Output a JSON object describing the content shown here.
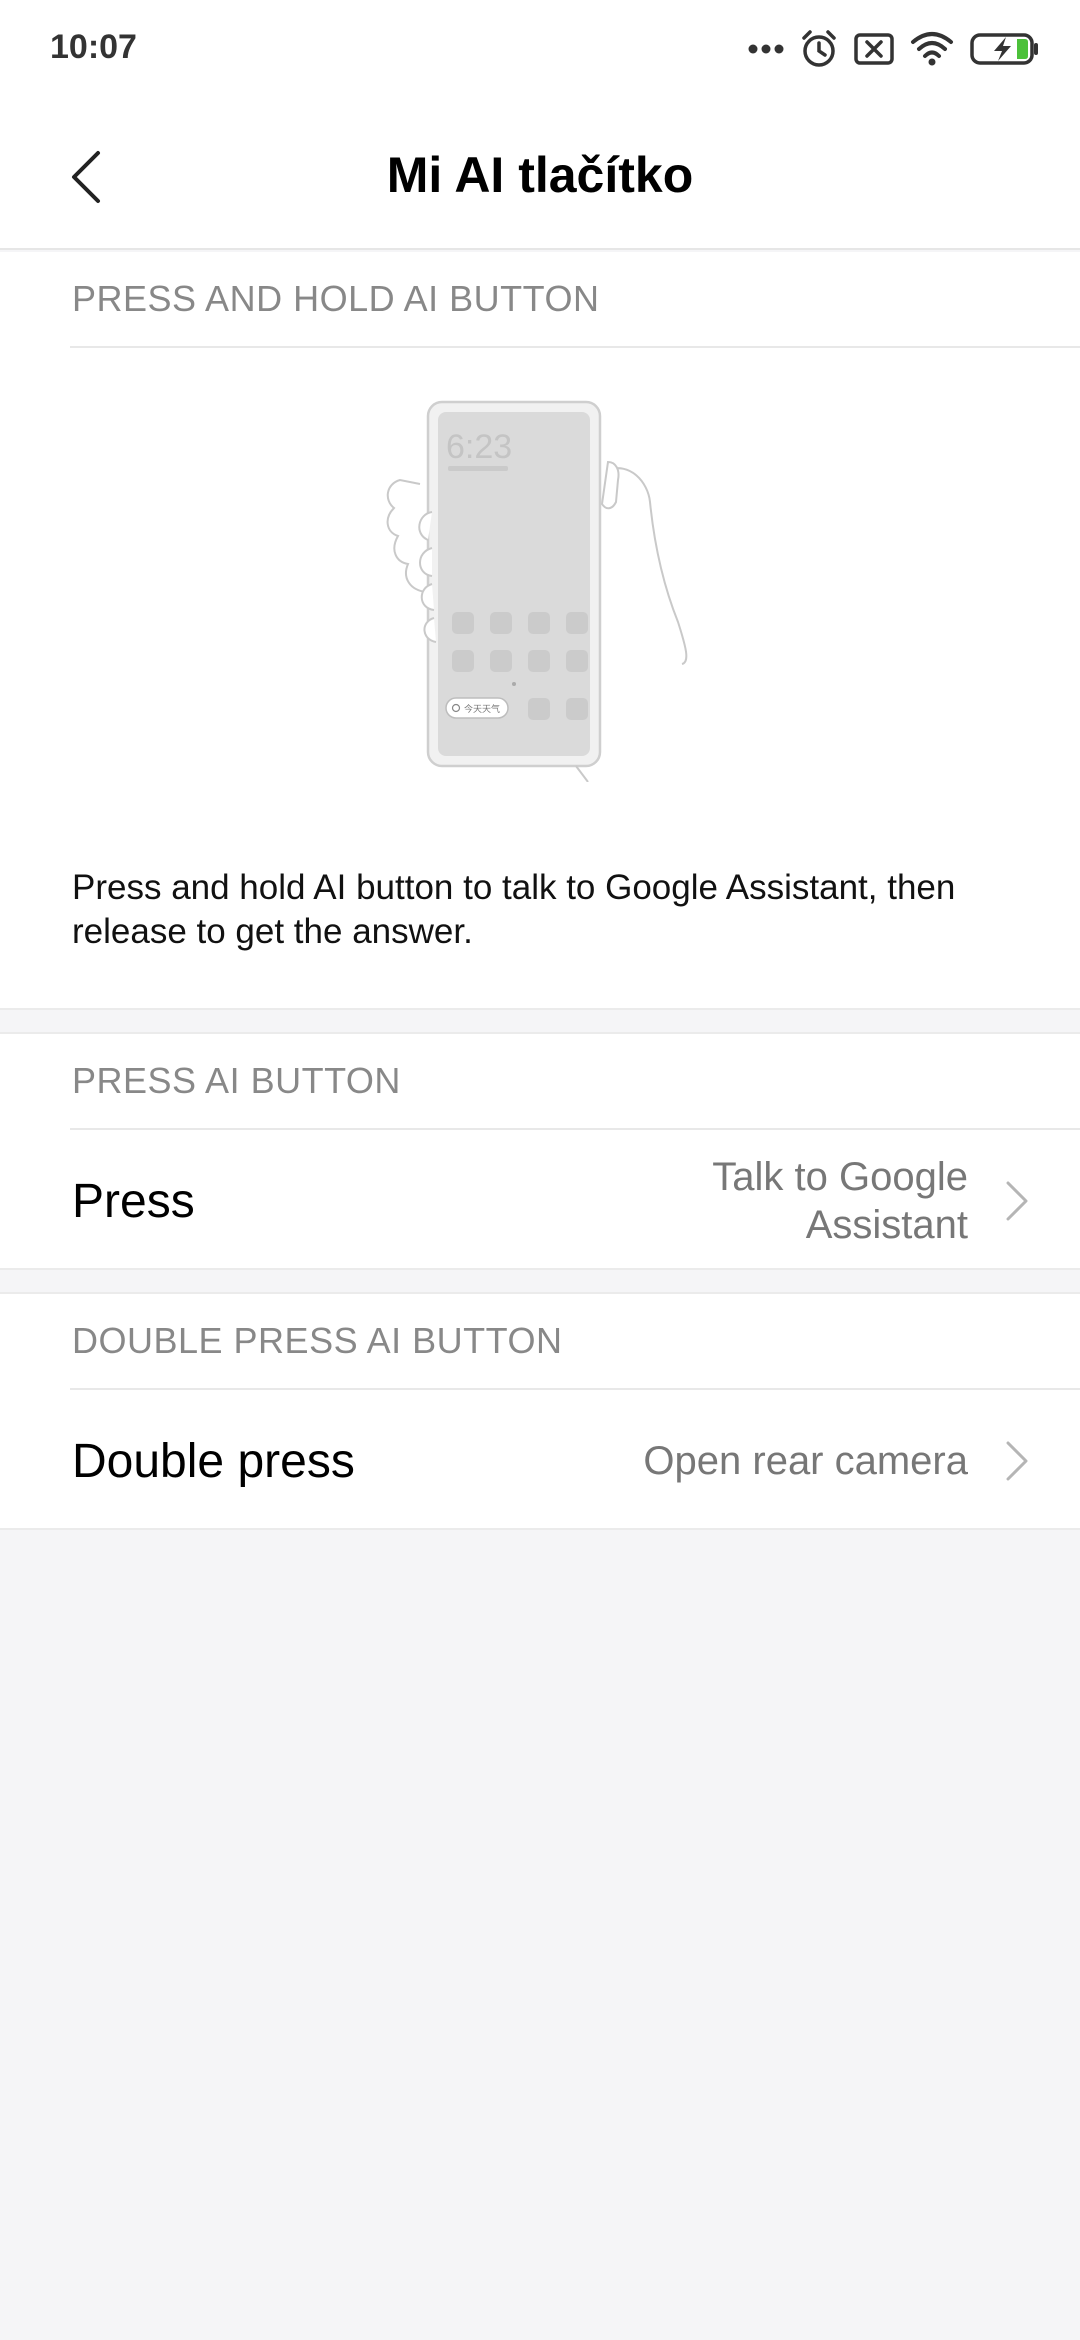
{
  "status_bar": {
    "time": "10:07",
    "icons": [
      "more-dots-icon",
      "alarm-icon",
      "notification-x-icon",
      "wifi-icon",
      "battery-charging-icon"
    ],
    "battery_color": "#4cc13a"
  },
  "header": {
    "title": "Mi AI tlačítko",
    "back_icon": "back-arrow-icon"
  },
  "sections": {
    "hold": {
      "header": "PRESS AND HOLD AI BUTTON",
      "illustration": {
        "clock": "6:23",
        "pill": "今天天气"
      },
      "description": "Press and hold AI button to talk to Google Assistant, then release to get the answer."
    },
    "press": {
      "header": "PRESS AI BUTTON",
      "label": "Press",
      "value": "Talk to Google Assistant"
    },
    "double": {
      "header": "DOUBLE PRESS AI BUTTON",
      "label": "Double press",
      "value": "Open rear camera"
    }
  }
}
